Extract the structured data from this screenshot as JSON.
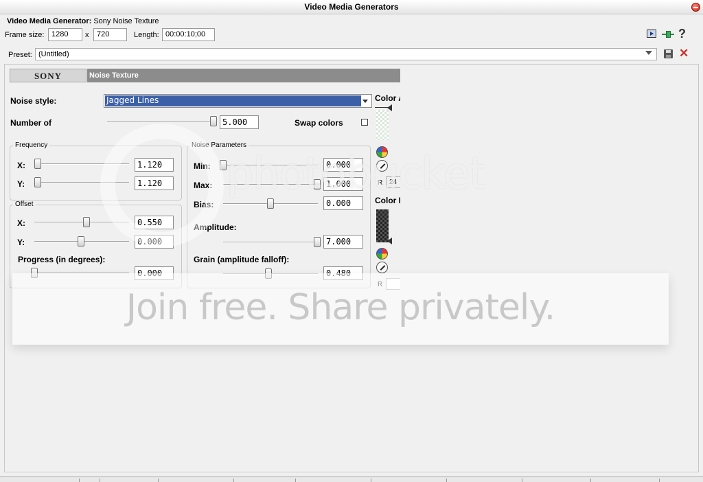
{
  "window": {
    "title": "Video Media Generators"
  },
  "header": {
    "generator_label": "Video Media Generator:",
    "generator_name": "Sony Noise Texture",
    "frame_size_label": "Frame size:",
    "frame_width": "1280",
    "x_sep": "x",
    "frame_height": "720",
    "length_label": "Length:",
    "length_value": "00:00:10;00"
  },
  "preset": {
    "label": "Preset:",
    "value": "(Untitled)"
  },
  "plugin": {
    "brand": "SONY",
    "name": "Noise Texture"
  },
  "controls": {
    "noise_style_label": "Noise style:",
    "noise_style_value": "Jagged Lines",
    "number_of_label": "Number of",
    "number_of_value": "5.000",
    "swap_colors_label": "Swap colors",
    "swap_colors_checked": false
  },
  "frequency": {
    "title": "Frequency",
    "x_label": "X:",
    "x_value": "1.120",
    "y_label": "Y:",
    "y_value": "1.120"
  },
  "offset": {
    "title": "Offset",
    "x_label": "X:",
    "x_value": "0.550",
    "y_label": "Y:",
    "y_value": "0.000",
    "progress_label": "Progress (in degrees):",
    "progress_value": "0.000"
  },
  "noise_params": {
    "title": "Noise Parameters",
    "min_label": "Min:",
    "min_value": "0.000",
    "max_label": "Max:",
    "max_value": "1.000",
    "bias_label": "Bias:",
    "bias_value": "0.000",
    "amplitude_label": "Amplitude:",
    "amplitude_value": "7.000",
    "grain_label": "Grain (amplitude falloff):",
    "grain_value": "0.480"
  },
  "colors": {
    "color_a_label": "Color A",
    "color_b_label": "Color B",
    "r_label": "R",
    "r_a_value": "24",
    "r_b_value": ""
  },
  "watermark": {
    "brand": "photobucket",
    "tagline": "Join free. Share privately."
  },
  "theme": {
    "accent": "#3b60a8",
    "strip": "#8c8c8c"
  }
}
